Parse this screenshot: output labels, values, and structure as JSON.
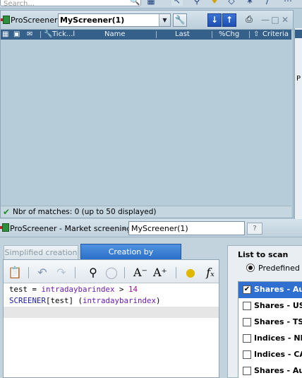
{
  "top": {
    "search_placeholder": "Search..."
  },
  "screener": {
    "title": "ProScreener",
    "selected_screener": "MyScreener(1)",
    "columns": [
      "Tick...l",
      "Name",
      "Last",
      "%Chg",
      "Criteria"
    ],
    "matches_text": "Nbr of matches: 0 (up to 50 displayed)"
  },
  "side": {
    "partial_label": "P"
  },
  "market": {
    "title": "ProScreener - Market screening",
    "separator": "-",
    "screener_name": "MyScreener(1)",
    "tabs": [
      "Simplified creation",
      "Creation by programming"
    ],
    "active_tab": "Creation by programming",
    "code_lines": [
      {
        "parts": [
          {
            "t": "test = ",
            "c": "plain"
          },
          {
            "t": "intradaybarindex",
            "c": "kw"
          },
          {
            "t": " > ",
            "c": "plain"
          },
          {
            "t": "14",
            "c": "num"
          }
        ]
      },
      {
        "parts": [
          {
            "t": "SCREENER",
            "c": "kw2"
          },
          {
            "t": "[test] (",
            "c": "plain"
          },
          {
            "t": "intradaybarindex",
            "c": "kw"
          },
          {
            "t": ")",
            "c": "plain"
          }
        ]
      },
      {
        "parts": []
      }
    ]
  },
  "scan": {
    "title": "List to scan",
    "radio_label": "Predefined",
    "items": [
      {
        "label": "Shares - Aus",
        "checked": true,
        "selected": true
      },
      {
        "label": "Shares - US (",
        "checked": false,
        "selected": false
      },
      {
        "label": "Shares - TSE",
        "checked": false,
        "selected": false
      },
      {
        "label": "Indices - NIKK",
        "checked": false,
        "selected": false
      },
      {
        "label": "Indices - CAC",
        "checked": false,
        "selected": false
      },
      {
        "label": "Shares - Aus",
        "checked": false,
        "selected": false
      }
    ]
  },
  "colors": {
    "header_bar": "#34608a",
    "active_tab": "#2c6fc9",
    "selected_item": "#2f6fcf",
    "check_green": "#1e8f26"
  }
}
